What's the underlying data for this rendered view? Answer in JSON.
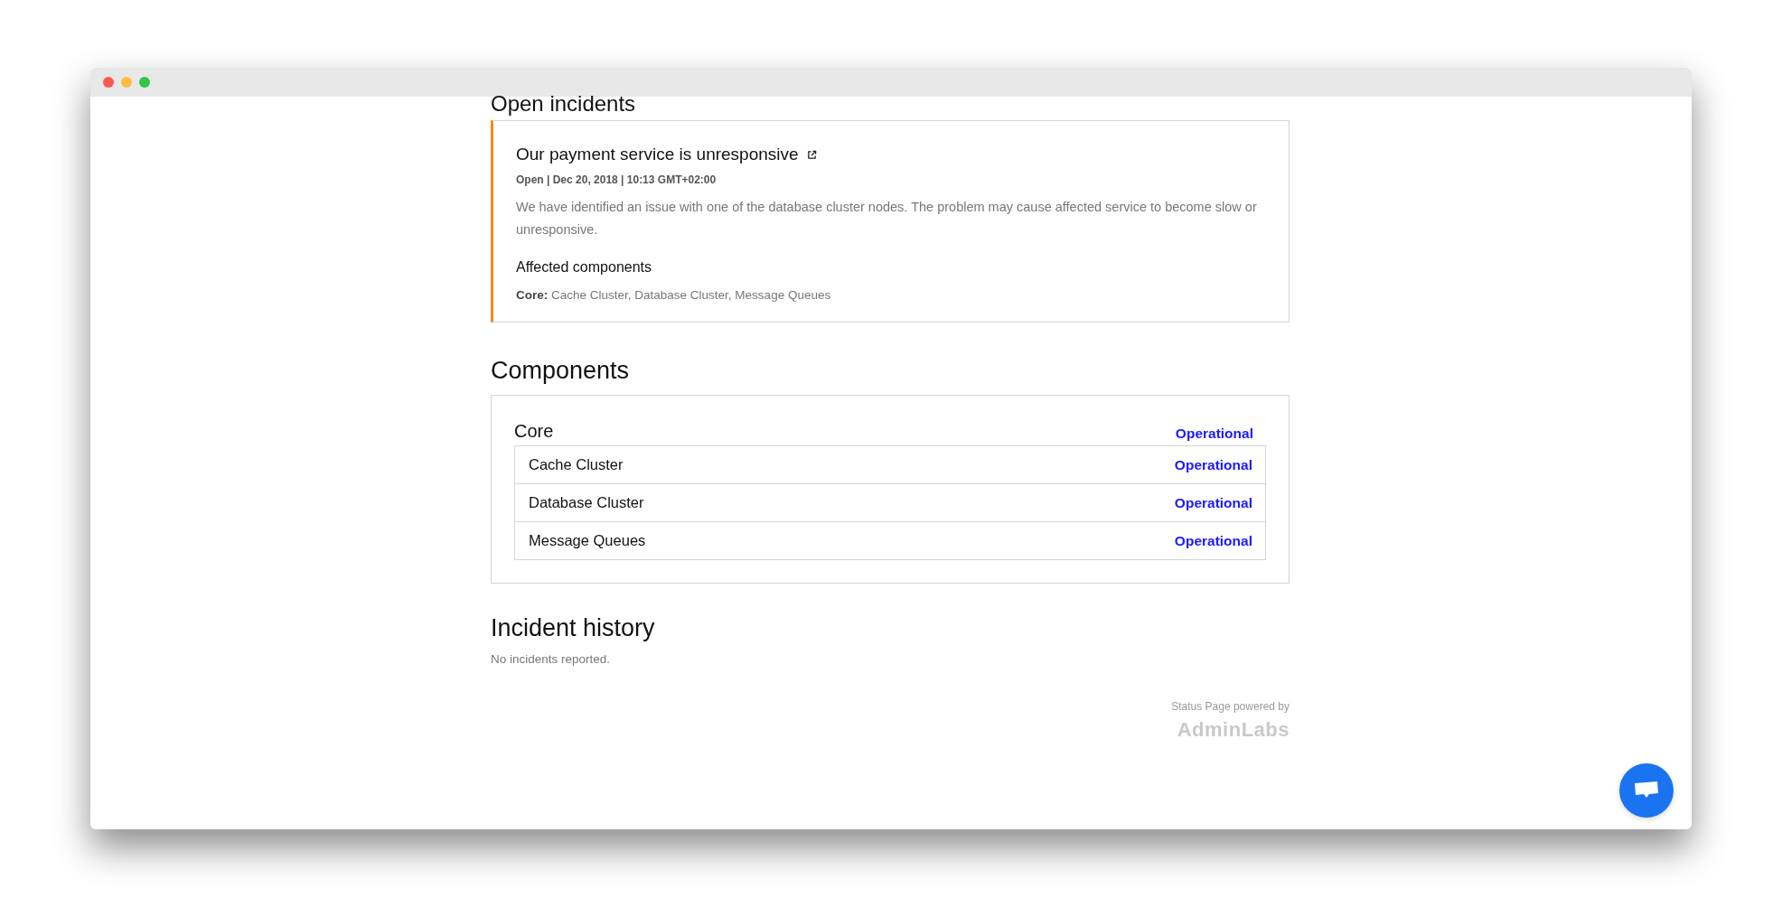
{
  "open_incidents": {
    "heading": "Open incidents",
    "incidents": [
      {
        "title": "Our payment service is unresponsive",
        "meta": "Open | Dec 20, 2018 | 10:13 GMT+02:00",
        "description": "We have identified an issue with one of the database cluster nodes. The problem may cause affected service to become slow or unresponsive.",
        "affected_heading": "Affected components",
        "affected": [
          "**Core:** Cache Cluster, Database Cluster, Message Queues"
        ]
      }
    ]
  },
  "components": {
    "heading": "Components",
    "groups": [
      {
        "name": "Core",
        "status": "Operational",
        "items": [
          {
            "name": "Cache Cluster",
            "status": "Operational"
          },
          {
            "name": "Database Cluster",
            "status": "Operational"
          },
          {
            "name": "Message Queues",
            "status": "Operational"
          }
        ]
      }
    ]
  },
  "incident_history": {
    "heading": "Incident history",
    "message": "No incidents reported."
  },
  "footer": {
    "powered_by": "Status Page powered by",
    "brand": "AdminLabs"
  }
}
